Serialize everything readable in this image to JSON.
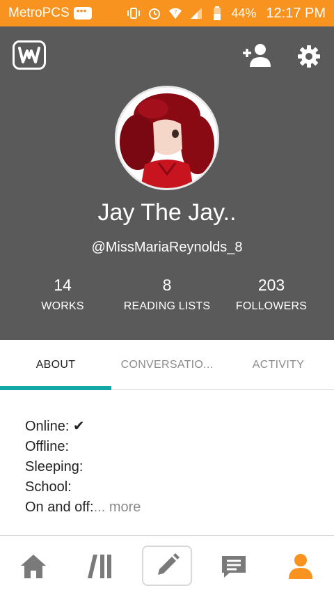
{
  "status_bar": {
    "carrier": "MetroPCS",
    "battery_percent": "44%",
    "time": "12:17 PM",
    "icons": [
      "message-icon",
      "vibrate-icon",
      "alarm-icon",
      "wifi-icon",
      "signal-icon",
      "battery-icon"
    ]
  },
  "header": {
    "logo_icon": "wattpad-logo-icon",
    "add_user_icon": "add-user-icon",
    "settings_icon": "gear-icon"
  },
  "profile": {
    "display_name": "Jay The Jay..",
    "username": "@MissMariaReynolds_8",
    "stats": [
      {
        "value": "14",
        "label": "WORKS"
      },
      {
        "value": "8",
        "label": "READING LISTS"
      },
      {
        "value": "203",
        "label": "FOLLOWERS"
      }
    ]
  },
  "tabs": [
    {
      "label": "ABOUT",
      "active": true
    },
    {
      "label": "CONVERSATIO...",
      "active": false
    },
    {
      "label": "ACTIVITY",
      "active": false
    }
  ],
  "about": {
    "lines": [
      "Online: ✔",
      "Offline:",
      "Sleeping:",
      "School:"
    ],
    "last_line": "On and off:",
    "more_label": "... more"
  },
  "bottom_nav": [
    {
      "icon": "home-icon"
    },
    {
      "icon": "library-icon"
    },
    {
      "icon": "pencil-icon"
    },
    {
      "icon": "messages-icon"
    },
    {
      "icon": "profile-icon",
      "active": true
    }
  ],
  "colors": {
    "status_bar": "#f7931e",
    "header_bg": "#5a5a5a",
    "tab_indicator": "#12a8a8",
    "active_nav": "#f7931e",
    "inactive_nav": "#7a7a7a"
  }
}
